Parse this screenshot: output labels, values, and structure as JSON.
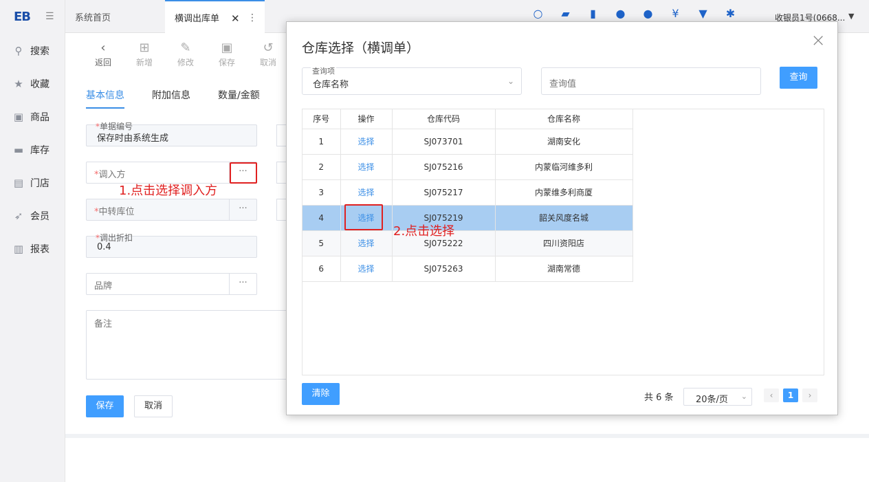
{
  "app": {
    "logo": "EB",
    "collapse_icon": "menu-fold-icon"
  },
  "sidebar": {
    "items": [
      {
        "label": "搜索",
        "icon": "search-icon"
      },
      {
        "label": "收藏",
        "icon": "star-icon"
      },
      {
        "label": "商品",
        "icon": "goods-icon"
      },
      {
        "label": "库存",
        "icon": "inventory-icon"
      },
      {
        "label": "门店",
        "icon": "store-icon"
      },
      {
        "label": "会员",
        "icon": "rocket-icon"
      },
      {
        "label": "报表",
        "icon": "chart-icon"
      }
    ]
  },
  "tabs": {
    "home": "系统首页",
    "active": "横调出库单",
    "close": "✕",
    "menu": "⋮"
  },
  "topbar": {
    "user": "收银员1号(0668...",
    "caret": "▼"
  },
  "toolbar": {
    "back": "返回",
    "add": "新增",
    "edit": "修改",
    "save": "保存",
    "cancel": "取消"
  },
  "subtabs": [
    "基本信息",
    "附加信息",
    "数量/金额"
  ],
  "form": {
    "doc_no_label": "单据编号",
    "doc_no_value": "保存时由系统生成",
    "transfer_in_label": "调入方",
    "transit_label": "中转库位",
    "discount_label": "调出折扣",
    "discount_value": "0.4",
    "brand_placeholder": "品牌",
    "remark_placeholder": "备注",
    "more_symbol": "···",
    "required_mark": "*",
    "save_button": "保存",
    "cancel_button": "取消"
  },
  "annotations": {
    "step1": "1.点击选择调入方",
    "step2": "2.点击选择"
  },
  "modal": {
    "title": "仓库选择（横调单）",
    "close": "×",
    "query_item_label": "查询项",
    "query_item_value": "仓库名称",
    "query_value_placeholder": "查询值",
    "query_button": "查询",
    "clear_button": "清除",
    "columns": [
      "序号",
      "操作",
      "仓库代码",
      "仓库名称"
    ],
    "rows": [
      {
        "no": "1",
        "action": "选择",
        "code": "SJ073701",
        "name": "湖南安化"
      },
      {
        "no": "2",
        "action": "选择",
        "code": "SJ075216",
        "name": "内蒙临河维多利"
      },
      {
        "no": "3",
        "action": "选择",
        "code": "SJ075217",
        "name": "内蒙维多利商厦"
      },
      {
        "no": "4",
        "action": "选择",
        "code": "SJ075219",
        "name": "韶关风度名城"
      },
      {
        "no": "5",
        "action": "选择",
        "code": "SJ075222",
        "name": "四川资阳店"
      },
      {
        "no": "6",
        "action": "选择",
        "code": "SJ075263",
        "name": "湖南常德"
      }
    ],
    "selected_row": 4,
    "pager": {
      "total": "共 6 条",
      "page_size": "20条/页",
      "current_page": "1",
      "prev": "‹",
      "next": "›"
    }
  },
  "colors": {
    "accent": "#409eff",
    "annotation": "#e02020",
    "selected_row": "#a8cdf2"
  }
}
